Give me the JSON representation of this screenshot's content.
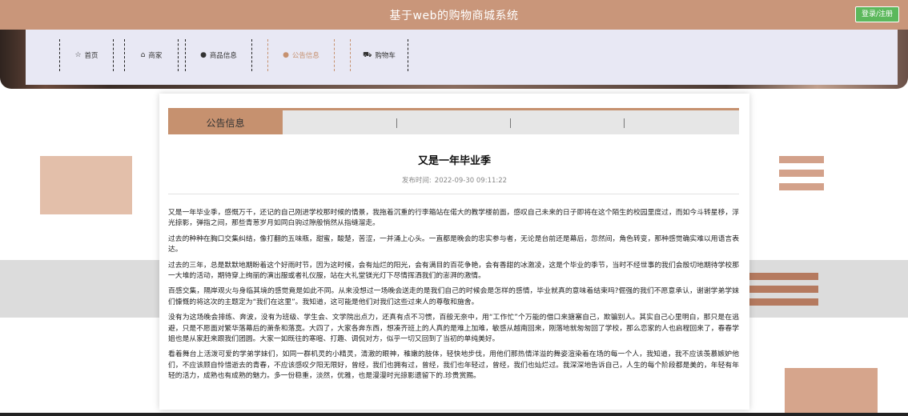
{
  "header": {
    "site_title": "基于web的购物商城系统",
    "login_label": "登录/注册",
    "accent_color": "#c9967a"
  },
  "nav": {
    "items": [
      {
        "label": "首页",
        "icon": "star-icon"
      },
      {
        "label": "商家",
        "icon": "home-icon"
      },
      {
        "label": "商品信息",
        "icon": "info-circle-icon"
      },
      {
        "label": "公告信息",
        "icon": "info-circle-icon",
        "active": true
      },
      {
        "label": "购物车",
        "icon": "cart-icon"
      }
    ]
  },
  "tabs": {
    "active_label": "公告信息"
  },
  "article": {
    "title": "又是一年毕业季",
    "publish_label": "发布时间:",
    "publish_time": "2022-09-30 09:11:22",
    "paragraphs": [
      "又是一年毕业季，感慨万千，还记的自己刚进学校那时候的情景，我拖着沉重的行李箱站在偌大的教学楼前面，感叹自己未来的日子即将在这个陌生的校园里度过，而如今斗转星移，浮光掠影，弹指之间，那些青葱岁月如同白驹过隙般悄然从指缝溜走。",
      "过去的种种在胸口交集纠结，像打翻的五味瓶，甜蜜，酸楚，苦涩，一并涌上心头。一直都是晚会的忠实参与者，无论是台前还是幕后，忽然间，角色转变，那种感觉确实难以用语言表达。",
      "过去的三年，总是默默地期盼着这个好雨时节，因为这时候，会有灿烂的阳光，会有满目的百花争艳，会有香甜的冰激凌，这是个毕业的季节，当时不经世事的我们会殷切地期待学校那一大堆的活动，期待穿上绚丽的演出服或者礼仪服，站在大礼堂镁光灯下尽情挥洒我们的澎湃的激情。",
      "百感交集，隔岸观火与身临其境的感觉竟是如此不同。从来没想过一场晚会送走的是我们自己的时候会是怎样的感情，毕业就真的意味着结束吗?倔强的我们不愿意承认，谢谢学弟学妹们慷慨的将这次的主题定为“我们在这里”。我知道，这可能是他们对我们这些过来人的尊敬和施舍。",
      "没有为这场晚会排练、奔波，没有为班级、学生会、文学院出点力，还真有点不习惯，百般无奈中，用“工作忙”个万能的借口来搪塞自己，欺骗别人。其实自己心里明白，那只是在逃避，只是不愿面对繁华落幕后的萧条和落寞。大四了，大家各奔东西，想凑齐班上的人真的是难上加难，敏感从越南回来，刚落地就匆匆回了学校，那么恋家的人也启程回来了，春春学姐也是从家赶来跟我们团圆。大家一如既往的寒暄、打趣、调侃对方，似乎一切又回到了当初的单纯美好。",
      "看着舞台上活泼可爱的学弟学妹们，如同一群机灵的小精灵，清澈的眼神，稚嫩的肢体，轻快地步伐，用他们那热情洋溢的舞姿渲染着在场的每一个人，我知道，我不应该羡慕嫉妒他们，不应该顾自怜惜逝去的青春，不应该感叹夕阳无限好，曾经，我们也拥有过，曾经，我们也年轻过，曾经，我们也灿烂过。我深深地告诉自己，人生的每个阶段都是美的，年轻有年轻的活力，成熟也有成熟的魅力。多一份稳重，淡然，优雅，也是漫漫时光掠影遗留下的.珍贵赏赐。"
    ]
  }
}
